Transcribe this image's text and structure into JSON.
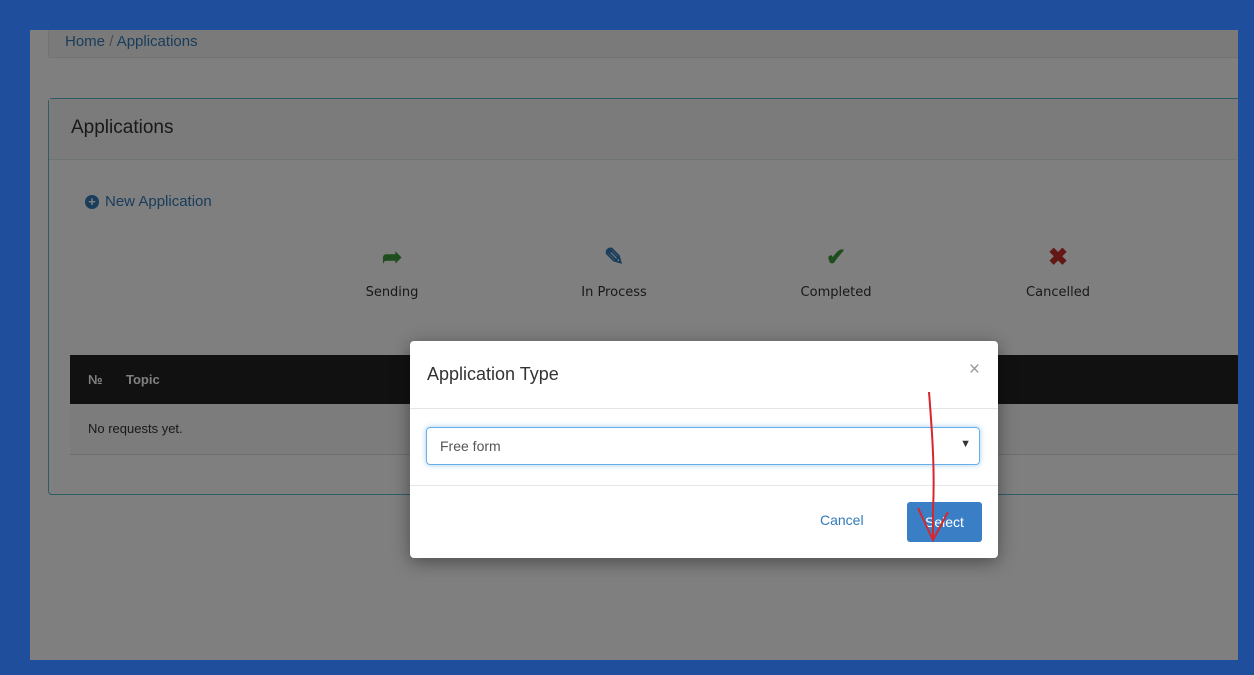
{
  "breadcrumb": {
    "home": "Home",
    "separator": "/",
    "current": "Applications"
  },
  "panel": {
    "title": "Applications",
    "new_application": "New Application"
  },
  "statuses": [
    {
      "label": "Sending",
      "icon": "share-arrow-icon",
      "color": "#3c9a3c"
    },
    {
      "label": "In Process",
      "icon": "edit-document-icon",
      "color": "#337ab7"
    },
    {
      "label": "Completed",
      "icon": "checkmark-icon",
      "color": "#3c9a3c"
    },
    {
      "label": "Cancelled",
      "icon": "x-mark-icon",
      "color": "#c9302c"
    }
  ],
  "table": {
    "columns": [
      "№",
      "Topic"
    ],
    "empty_message": "No requests yet."
  },
  "modal": {
    "title": "Application Type",
    "close": "×",
    "select_value": "Free form",
    "cancel_label": "Cancel",
    "select_label": "Select"
  },
  "colors": {
    "frame_border": "#1f4f9c",
    "primary": "#337ab7",
    "annotation": "#d9262c"
  }
}
